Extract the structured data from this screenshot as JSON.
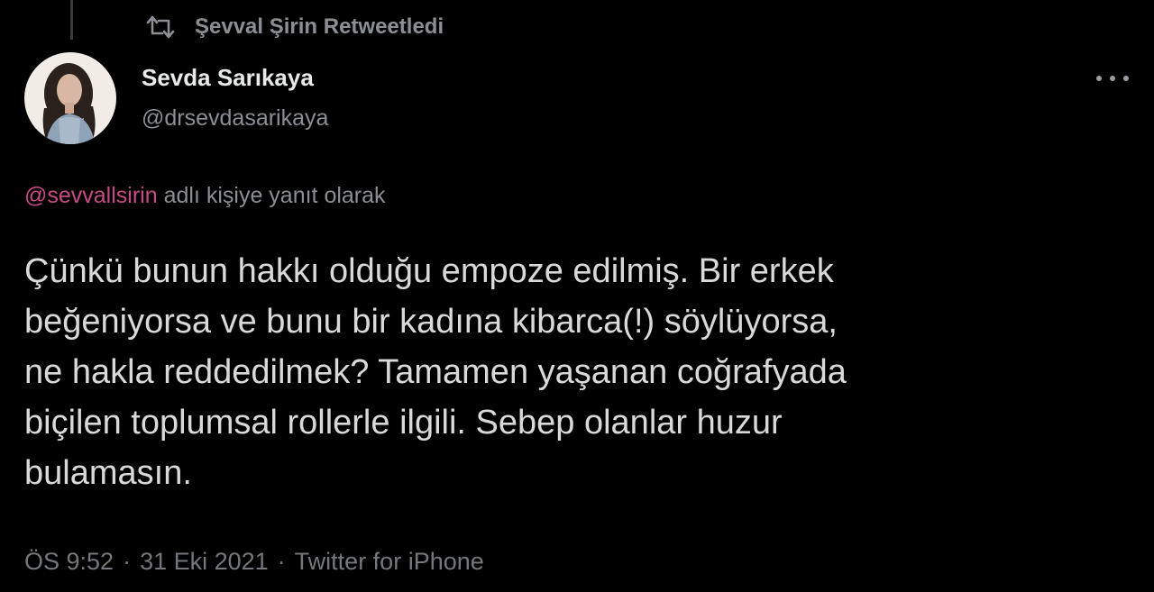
{
  "retweet": {
    "icon": "retweet-icon",
    "label": "Şevval Şirin Retweetledi"
  },
  "author": {
    "display_name": "Sevda Sarıkaya",
    "handle": "@drsevdasarikaya",
    "avatar": "profile-photo"
  },
  "menu": {
    "icon": "more-options-icon"
  },
  "reply_context": {
    "mention": "@sevvallsirin",
    "suffix": "adlı kişiye yanıt olarak"
  },
  "tweet": {
    "lines": [
      "Çünkü bunun hakkı olduğu empoze edilmiş. Bir erkek",
      "beğeniyorsa ve bunu bir kadına kibarca(!) söylüyorsa,",
      "ne hakla reddedilmek? Tamamen yaşanan coğrafyada",
      "biçilen toplumsal rollerle ilgili. Sebep olanlar huzur",
      "bulamasın."
    ]
  },
  "meta": {
    "time": "ÖS 9:52",
    "date": "31 Eki 2021",
    "source": "Twitter for iPhone",
    "separator": "·"
  },
  "colors": {
    "background": "#000000",
    "mention": "#c54b87",
    "muted": "#8b8f93"
  }
}
